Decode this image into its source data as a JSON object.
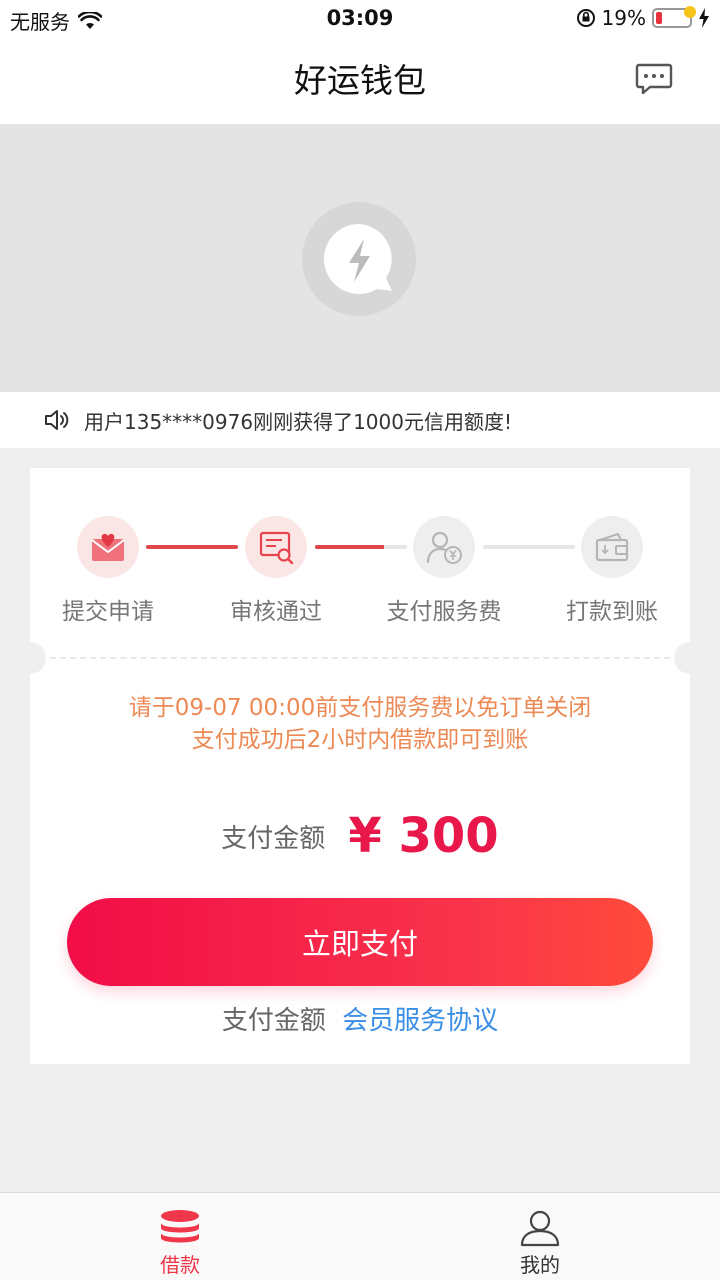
{
  "status_bar": {
    "carrier": "无服务",
    "time": "03:09",
    "battery_percent": "19%",
    "battery_level": 0.19
  },
  "nav": {
    "title": "好运钱包",
    "message_icon": "chat-bubble-icon"
  },
  "notice": {
    "icon": "speaker-icon",
    "text": "用户135****0976刚刚获得了1000元信用额度!"
  },
  "progress": {
    "steps": [
      {
        "label": "提交申请",
        "icon": "envelope-heart-icon",
        "state": "done"
      },
      {
        "label": "审核通过",
        "icon": "document-search-icon",
        "state": "done"
      },
      {
        "label": "支付服务费",
        "icon": "user-yuan-icon",
        "state": "pending"
      },
      {
        "label": "打款到账",
        "icon": "wallet-icon",
        "state": "pending"
      }
    ],
    "connector_fill": [
      1,
      0.75,
      0
    ]
  },
  "warning": {
    "line1": "请于09-07 00:00前支付服务费以免订单关闭",
    "line2": "支付成功后2小时内借款即可到账"
  },
  "payment": {
    "amount_label": "支付金额",
    "amount_value": "¥ 300",
    "pay_button": "立即支付",
    "agree_label": "支付金额",
    "agree_link": "会员服务协议"
  },
  "tabbar": {
    "tabs": [
      {
        "label": "借款",
        "icon": "coins-stack-icon",
        "active": true
      },
      {
        "label": "我的",
        "icon": "user-icon",
        "active": false
      }
    ]
  },
  "colors": {
    "accent": "#f0374a",
    "warning": "#ec8a55",
    "link": "#3a8ee6"
  }
}
